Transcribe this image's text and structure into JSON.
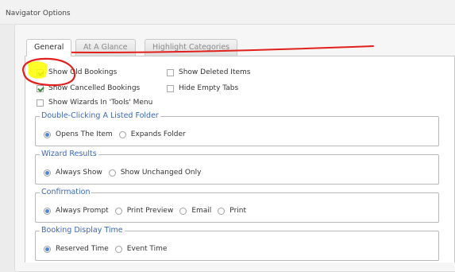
{
  "window": {
    "title": "Navigator Options"
  },
  "tabs": [
    {
      "label": "General",
      "active": true
    },
    {
      "label": "At A Glance",
      "active": false
    },
    {
      "label": "Highlight Categories",
      "active": false
    }
  ],
  "general": {
    "checkboxes": [
      {
        "label": "Show Old Bookings",
        "checked": true
      },
      {
        "label": "Show Deleted Items",
        "checked": false
      },
      {
        "label": "Show Cancelled Bookings",
        "checked": true
      },
      {
        "label": "Hide Empty Tabs",
        "checked": false
      },
      {
        "label": "Show Wizards In 'Tools' Menu",
        "checked": false
      }
    ],
    "groups": [
      {
        "legend": "Double-Clicking A Listed Folder",
        "options": [
          {
            "label": "Opens The Item",
            "selected": true
          },
          {
            "label": "Expands Folder",
            "selected": false
          }
        ]
      },
      {
        "legend": "Wizard Results",
        "options": [
          {
            "label": "Always Show",
            "selected": true
          },
          {
            "label": "Show Unchanged Only",
            "selected": false
          }
        ]
      },
      {
        "legend": "Confirmation",
        "options": [
          {
            "label": "Always Prompt",
            "selected": true
          },
          {
            "label": "Print Preview",
            "selected": false
          },
          {
            "label": "Email",
            "selected": false
          },
          {
            "label": "Print",
            "selected": false
          }
        ]
      },
      {
        "legend": "Booking Display Time",
        "options": [
          {
            "label": "Reserved Time",
            "selected": true
          },
          {
            "label": "Event Time",
            "selected": false
          }
        ]
      }
    ]
  },
  "annotation_color": "#e0201c",
  "highlight_color": "#ffff00"
}
